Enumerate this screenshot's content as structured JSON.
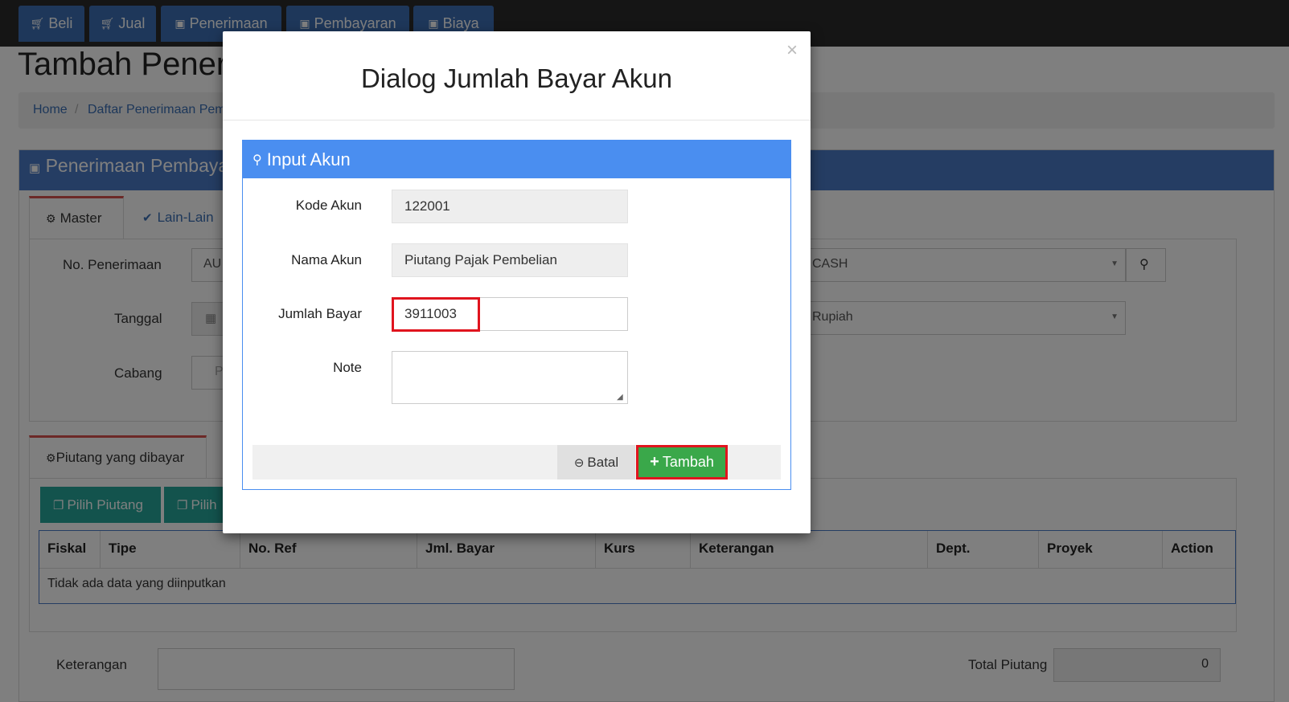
{
  "nav": {
    "buttons": [
      {
        "label": "Beli",
        "icon": "cart-icon"
      },
      {
        "label": "Jual",
        "icon": "cart-icon"
      },
      {
        "label": "Penerimaan",
        "icon": "money-icon"
      },
      {
        "label": "Pembayaran",
        "icon": "money-icon"
      },
      {
        "label": "Biaya",
        "icon": "money-icon"
      }
    ],
    "user_line1": "",
    "user_line2": ""
  },
  "page": {
    "title": "Tambah Pener",
    "breadcrumb": [
      "Home",
      "Daftar Penerimaan Pem"
    ]
  },
  "panel": {
    "title": "Penerimaan Pembaya",
    "tabs": [
      "Master",
      "Lain-Lain"
    ],
    "fields": {
      "no_penerimaan_label": "No. Penerimaan",
      "no_penerimaan_value": "AU",
      "tanggal_label": "Tanggal",
      "cabang_label": "Cabang",
      "cabang_value": "P",
      "account_value": "CASH",
      "currency_value": "Rupiah"
    },
    "detail_tab": "Piutang yang dibayar",
    "buttons": [
      "Pilih Piutang",
      "Pilih"
    ],
    "table": {
      "columns": [
        "Fiskal",
        "Tipe",
        "No. Ref",
        "Jml. Bayar",
        "Kurs",
        "Keterangan",
        "Dept.",
        "Proyek",
        "Action"
      ],
      "empty_text": "Tidak ada data yang diinputkan"
    },
    "keterangan_label": "Keterangan",
    "total_piutang_label": "Total Piutang",
    "total_piutang_value": "0"
  },
  "modal": {
    "title": "Dialog Jumlah Bayar Akun",
    "close_label": "×",
    "section_title": "Input Akun",
    "kode_akun_label": "Kode Akun",
    "kode_akun_value": "122001",
    "nama_akun_label": "Nama Akun",
    "nama_akun_value": "Piutang Pajak Pembelian",
    "jumlah_bayar_label": "Jumlah Bayar",
    "jumlah_bayar_value": "3911003",
    "note_label": "Note",
    "note_value": "",
    "batal_label": "Batal",
    "tambah_label": "Tambah"
  },
  "colors": {
    "nav_button": "#3d6fb4",
    "panel_header": "#4a7ac7",
    "modal_section_header": "#4a8ef0",
    "tambah_button": "#3aa84a",
    "highlight": "#e0141e"
  }
}
